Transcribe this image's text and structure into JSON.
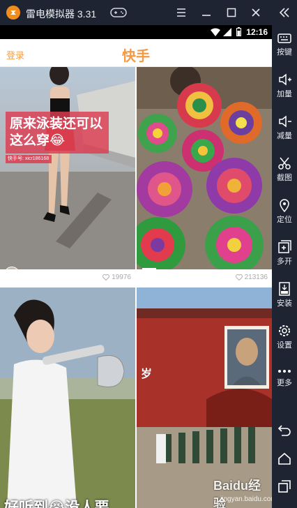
{
  "window": {
    "title": "雷电模拟器 3.31",
    "accent": "#f28c1c"
  },
  "status": {
    "time": "12:16"
  },
  "app": {
    "login_label": "登录",
    "title": "快手",
    "accent": "#f39a45"
  },
  "feed": {
    "cards": [
      {
        "caption_lines": [
          "原来泳装还可以",
          "这么穿😂"
        ],
        "author_tag": "快手号: xicr186168",
        "likes": "19976"
      },
      {
        "likes": "213136"
      },
      {
        "caption": "好听到😭没人要"
      },
      {
        "sign": "岁"
      }
    ]
  },
  "watermark": {
    "brand": "Baidu经验",
    "url": "jingyan.baidu.com"
  },
  "sidebar": {
    "items": [
      {
        "label": "按键",
        "icon": "keyboard-icon"
      },
      {
        "label": "加量",
        "icon": "volume-up-icon"
      },
      {
        "label": "减量",
        "icon": "volume-down-icon"
      },
      {
        "label": "截图",
        "icon": "scissors-icon"
      },
      {
        "label": "定位",
        "icon": "location-pin-icon"
      },
      {
        "label": "多开",
        "icon": "multi-open-icon"
      },
      {
        "label": "安装",
        "icon": "apk-install-icon"
      },
      {
        "label": "设置",
        "icon": "gear-icon"
      },
      {
        "label": "更多",
        "icon": "more-dots-icon"
      }
    ]
  }
}
